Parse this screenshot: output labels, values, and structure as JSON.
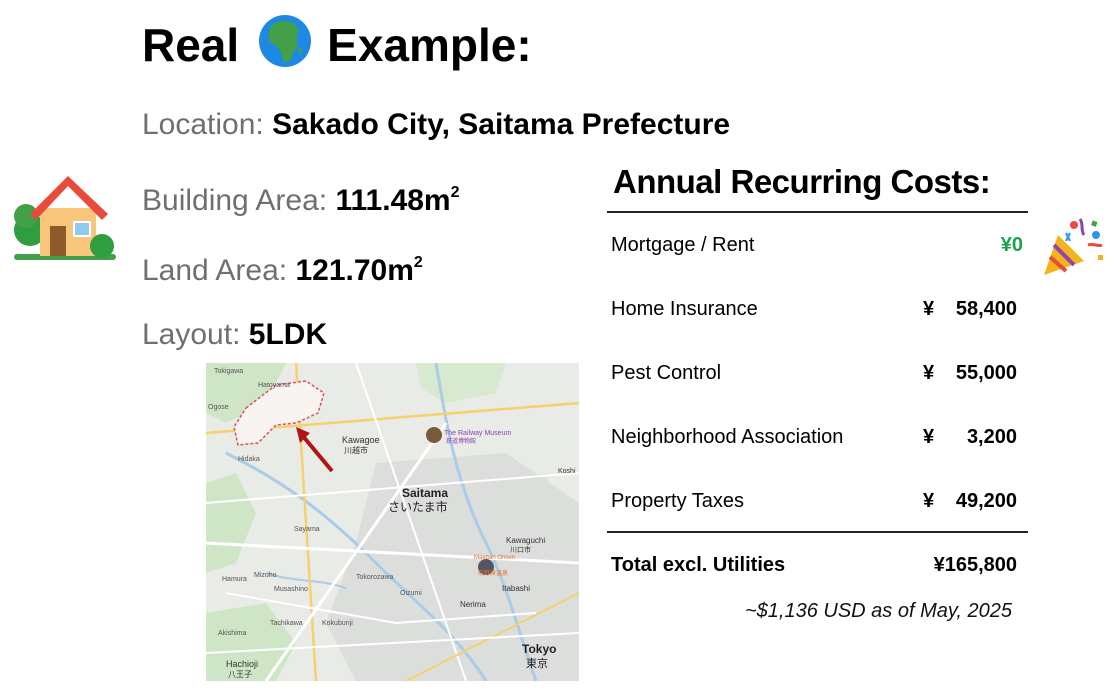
{
  "title": {
    "left": "Real",
    "right": "Example:"
  },
  "icons": {
    "title_icon": "globe-africa-icon",
    "house": "house-with-garden-icon",
    "party": "party-popper-icon"
  },
  "property": {
    "location": {
      "label": "Location:",
      "value": "Sakado City, Saitama Prefecture"
    },
    "building_area": {
      "label": "Building Area:",
      "value": "111.48m",
      "unit_sup": "2"
    },
    "land_area": {
      "label": "Land Area:",
      "value": "121.70m",
      "unit_sup": "2"
    },
    "layout": {
      "label": "Layout:",
      "value": "5LDK"
    }
  },
  "map": {
    "labels": {
      "tokigawa": "Tokigawa",
      "hatoyama": "Hatoyama",
      "ogose": "Ogose",
      "kawagoe": "Kawagoe",
      "kawagoe_jp": "川越市",
      "railway_museum": "The Railway Museum",
      "railway_museum_jp": "鉄道博物館",
      "hidaka": "Hidaka",
      "saitama": "Saitama",
      "saitama_jp": "さいたま市",
      "kawaguchi": "Kawaguchi",
      "kawaguchi_jp": "川口市",
      "koshi": "Koshi",
      "sayama": "Sayama",
      "musashino": "Musashino",
      "tokorozawa": "Tokorozawa",
      "oizumi": "Oizumi",
      "nerima": "Nerima",
      "itabashi": "Itabashi",
      "tokyo": "Tokyo",
      "tokyo_jp": "東京",
      "hachioji": "Hachioji",
      "hachioji_jp": "八王子",
      "hamura": "Hamura",
      "mizuho": "Mizuho",
      "akishima": "Akishima",
      "tachikawa": "Tachikawa",
      "kokubunji": "Kokubunji",
      "onsen": "Maebari Onsen",
      "onsen_jp": "前野原温泉"
    }
  },
  "costs": {
    "title": "Annual Recurring Costs:",
    "rows": [
      {
        "name": "Mortgage / Rent",
        "amount": "¥0"
      },
      {
        "name": "Home Insurance",
        "yen": "¥",
        "amount": "58,400"
      },
      {
        "name": "Pest Control",
        "yen": "¥",
        "amount": "55,000"
      },
      {
        "name": "Neighborhood Association",
        "yen": "¥",
        "amount": "3,200"
      },
      {
        "name": "Property Taxes",
        "yen": "¥",
        "amount": "49,200"
      }
    ],
    "total": {
      "name": "Total excl. Utilities",
      "amount": "¥165,800"
    },
    "note": "~$1,136 USD as of May, 2025"
  },
  "colors": {
    "label_gray": "#6f6f6f",
    "zero_green": "#1aa34a",
    "map_bg": "#e8eae6",
    "arrow_red": "#b01515",
    "city_outline": "#e05050"
  }
}
